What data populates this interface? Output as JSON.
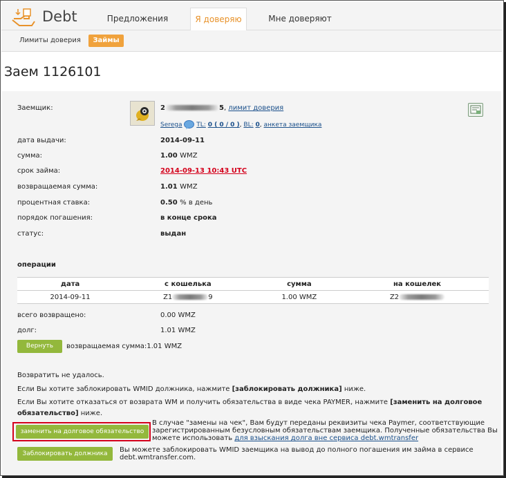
{
  "header": {
    "brand": "Debt",
    "tabs": [
      {
        "label": "Предложения"
      },
      {
        "label": "Я доверяю"
      },
      {
        "label": "Мне доверяют"
      }
    ]
  },
  "subnav": {
    "link": "Лимиты доверия",
    "active": "Займы"
  },
  "page_title": "Заем 1126101",
  "borrower": {
    "label": "Заемщик:",
    "wmid_start": "2",
    "wmid_end": "5",
    "limit_link": "лимит доверия",
    "nick": "Serega",
    "tl_label": "TL:",
    "tl_value": "0 ( 0 / 0 )",
    "bl_label": "BL:",
    "bl_value": "0",
    "profile_link": "анкета заемщика"
  },
  "details": [
    {
      "label": "дата выдачи:",
      "value": "2014-09-11",
      "unit": ""
    },
    {
      "label": "сумма:",
      "value": "1.00",
      "unit": "WMZ"
    },
    {
      "label": "срок займа:",
      "value": "2014-09-13 10:43 UTC",
      "unit": ""
    },
    {
      "label": "возвращаемая сумма:",
      "value": "1.01",
      "unit": "WMZ"
    },
    {
      "label": "процентная ставка:",
      "value": "0.50",
      "unit": "% в день"
    },
    {
      "label": "порядок погашения:",
      "value": "в конце срока",
      "unit": ""
    },
    {
      "label": "статус:",
      "value": "выдан",
      "unit": ""
    }
  ],
  "operations": {
    "title": "операции",
    "columns": [
      "дата",
      "с кошелька",
      "сумма",
      "на кошелек"
    ],
    "row": {
      "date": "2014-09-11",
      "from_start": "Z1",
      "from_end": "9",
      "amount": "1.00 WMZ",
      "to_start": "Z2"
    }
  },
  "totals": {
    "returned_label": "всего возвращено:",
    "returned_value": "0.00 WMZ",
    "debt_label": "долг:",
    "debt_value": "1.01 WMZ"
  },
  "return_button": "Вернуть",
  "return_sum_text": "возвращаемая сумма:1.01 WMZ",
  "messages": {
    "failed": "Возвратить не удалось.",
    "block_pre": "Если Вы хотите заблокировать WMID должника, нажмите ",
    "block_bold": "[заблокировать должника]",
    "block_post": " ниже.",
    "replace_pre": "Если Вы хотите отказаться от возврата WM и получить обязательства в виде чека PAYMER, нажмите ",
    "replace_bold1": "[заменить на долговое",
    "replace_bold2": "обязательство]",
    "replace_post": " ниже."
  },
  "replace_button": "заменить на долговое обязательство",
  "replace_info": {
    "line1": "В случае \"замены на чек\", Вам будут переданы реквизиты чека Paymer, соответствующие",
    "line2": "зарегистрированным безусловным обязательствам заемщика. Полученные обязательства Вы",
    "line3_pre": "можете использовать ",
    "line3_link": "для взыскания долга вне сервиса debt.wmtransfer"
  },
  "block_button": "Заблокировать должника",
  "block_info": {
    "line1": "Вы можете заблокировать WMID заемщика на вывод до полного погашения им займа в сервисе",
    "line2": "debt.wmtransfer.com."
  },
  "colors": {
    "accent": "#f0a23c",
    "button": "#93b83c",
    "warning": "#d4001b",
    "link": "#1a4f8a"
  }
}
